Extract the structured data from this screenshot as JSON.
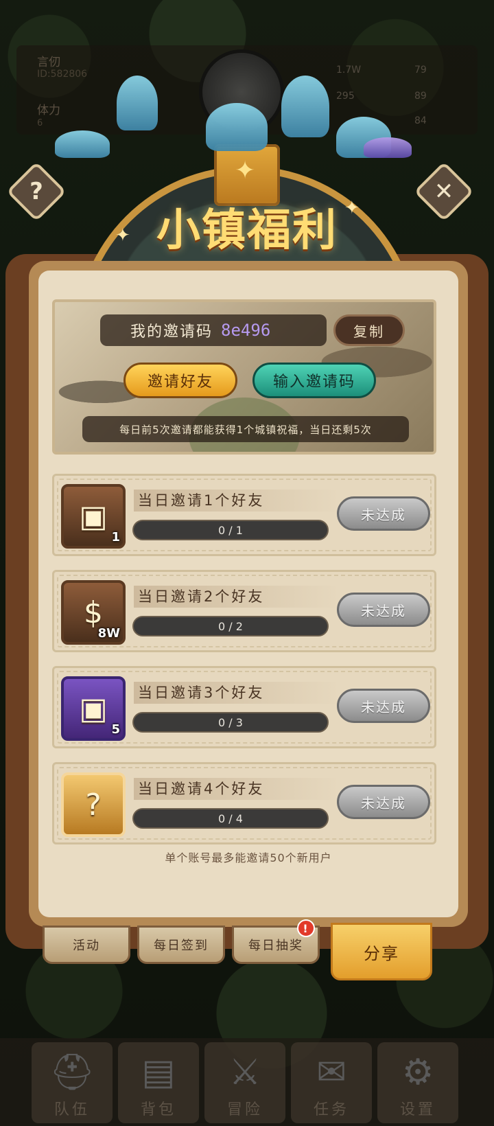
{
  "hud": {
    "player_name": "言仞",
    "player_id": "ID:582806",
    "stamina_label": "体力",
    "stamina_value": "6",
    "resources": [
      {
        "value": "1.7W"
      },
      {
        "value": "79"
      },
      {
        "value": "295"
      },
      {
        "value": "89"
      },
      {
        "value": "84"
      }
    ]
  },
  "banner": {
    "title": "小镇福利"
  },
  "help_glyph": "?",
  "invite": {
    "code_label": "我的邀请码",
    "code_value": "8e496",
    "copy_label": "复制",
    "invite_friends_label": "邀请好友",
    "enter_code_label": "输入邀请码",
    "info": "每日前5次邀请都能获得1个城镇祝福，当日还剩5次"
  },
  "tasks": [
    {
      "title": "当日邀请1个好友",
      "progress": "0 / 1",
      "reward_qty": "1",
      "status": "未达成"
    },
    {
      "title": "当日邀请2个好友",
      "progress": "0 / 2",
      "reward_qty": "8W",
      "status": "未达成"
    },
    {
      "title": "当日邀请3个好友",
      "progress": "0 / 3",
      "reward_qty": "5",
      "status": "未达成"
    },
    {
      "title": "当日邀请4个好友",
      "progress": "0 / 4",
      "reward_qty": "",
      "status": "未达成"
    }
  ],
  "footer_note": "单个账号最多能邀请50个新用户",
  "tabs": [
    {
      "label": "活动"
    },
    {
      "label": "每日签到"
    },
    {
      "label": "每日抽奖",
      "badge": "!"
    },
    {
      "label": "分享"
    }
  ],
  "nav": [
    {
      "label": "队伍",
      "icon": "helmet-icon"
    },
    {
      "label": "背包",
      "icon": "backpack-icon"
    },
    {
      "label": "冒险",
      "icon": "crossed-swords-icon"
    },
    {
      "label": "任务",
      "icon": "scroll-icon"
    },
    {
      "label": "设置",
      "icon": "gear-icon"
    }
  ],
  "colors": {
    "banner_title": "#ffdc74",
    "invite_button": "#f2b537",
    "enter_code_button": "#2fae96",
    "status_button": "#a9a9a9",
    "active_tab": "#eeb84a",
    "badge": "#e23a2a"
  }
}
